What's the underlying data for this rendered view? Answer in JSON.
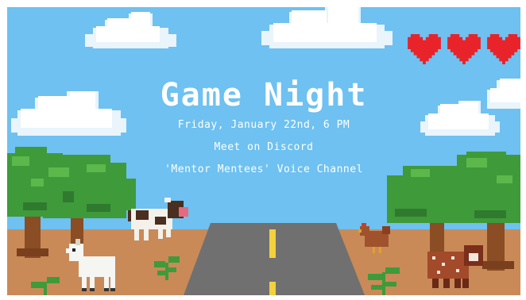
{
  "event": {
    "title": "Game Night",
    "date_time": "Friday, January 22nd, 6 PM",
    "location": "Meet on Discord",
    "channel": "'Mentor Mentees' Voice Channel"
  },
  "hearts": {
    "count": 3,
    "color": "#e8242a"
  },
  "colors": {
    "sky": "#6ec1f0",
    "ground": "#c98a58",
    "road": "#707070",
    "road_line": "#f2d13c",
    "tree_leaves": "#3f9a3a",
    "tree_trunk": "#8a4d24"
  }
}
